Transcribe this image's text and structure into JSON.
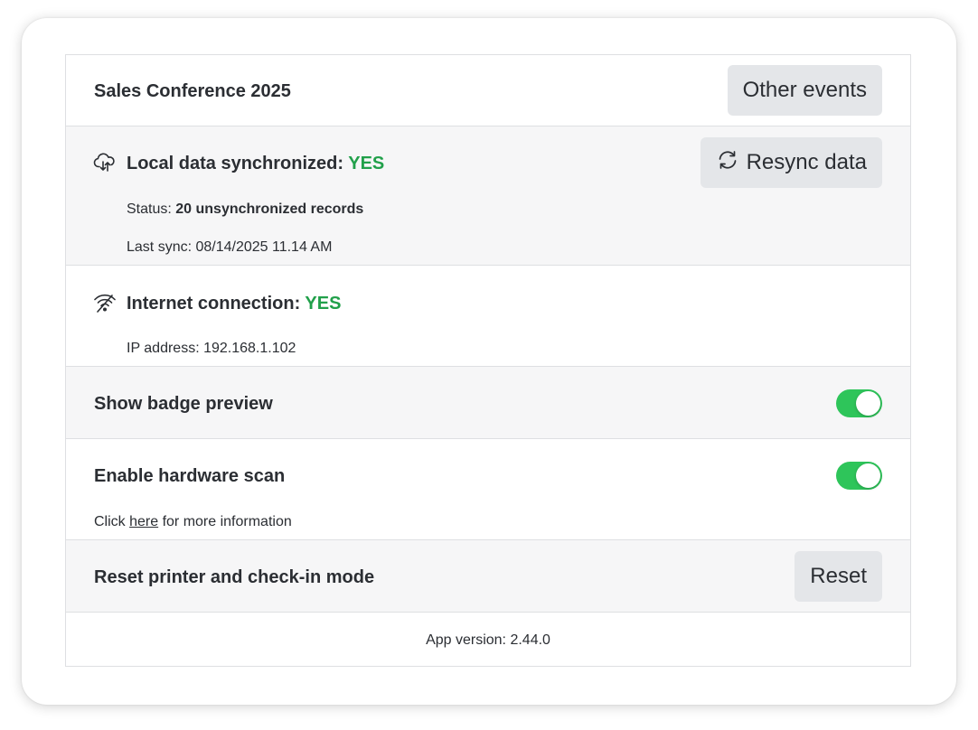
{
  "header": {
    "event_title": "Sales Conference 2025",
    "other_events_label": "Other events"
  },
  "sync": {
    "icon": "cloud-sync-icon",
    "title_prefix": "Local data synchronized: ",
    "title_value": "YES",
    "resync_label": "Resync data",
    "status_label": "Status: ",
    "status_value": "20 unsynchronized records",
    "last_sync": "Last sync: 08/14/2025 11.14 AM"
  },
  "internet": {
    "icon": "wifi-off-icon",
    "title_prefix": "Internet connection: ",
    "title_value": "YES",
    "ip": "IP address: 192.168.1.102"
  },
  "badge_preview": {
    "label": "Show badge preview",
    "enabled": true
  },
  "hardware_scan": {
    "label": "Enable hardware scan",
    "enabled": true,
    "info_prefix": "Click ",
    "info_link": "here",
    "info_suffix": " for more information"
  },
  "reset": {
    "label": "Reset printer and check-in mode",
    "button_label": "Reset"
  },
  "footer": {
    "version": "App version: 2.44.0"
  },
  "colors": {
    "accent_green": "#21a04a",
    "toggle_on": "#2ec55a",
    "button_bg": "#e4e6e9",
    "alt_row_bg": "#f6f6f7"
  }
}
